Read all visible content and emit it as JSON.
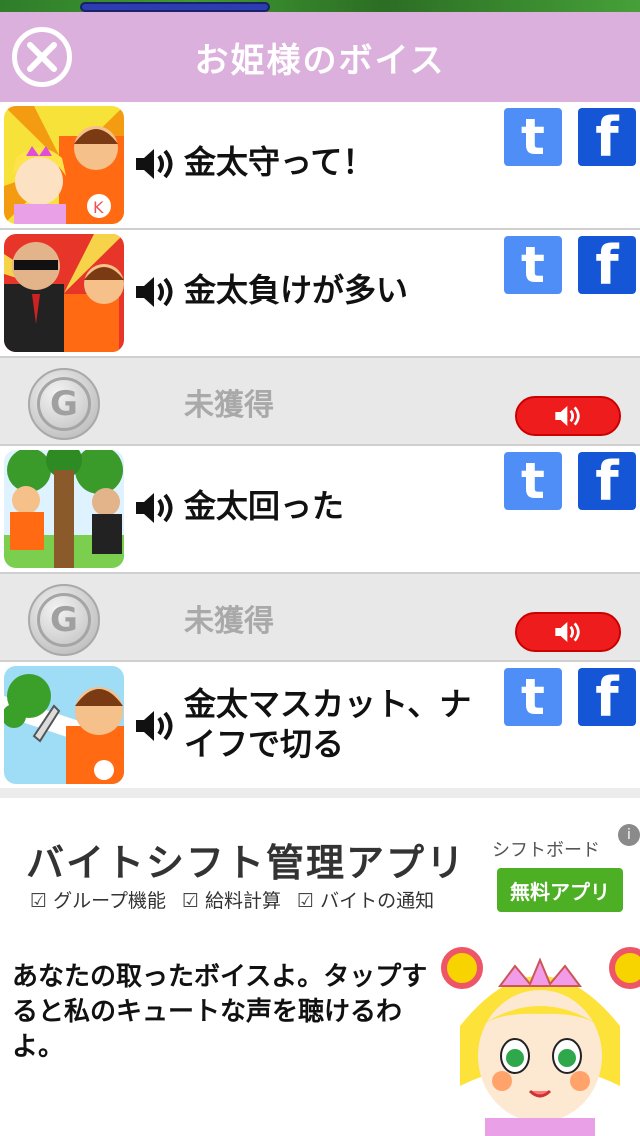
{
  "header": {
    "title": "お姫様のボイス"
  },
  "rows": [
    {
      "status": "unlocked",
      "title": "金太守って！"
    },
    {
      "status": "unlocked",
      "title": "金太負けが多い"
    },
    {
      "status": "locked",
      "coin_letter": "G",
      "label": "未獲得"
    },
    {
      "status": "unlocked",
      "title": "金太回った"
    },
    {
      "status": "locked",
      "coin_letter": "G",
      "label": "未獲得"
    },
    {
      "status": "unlocked",
      "title": "金太マスカット、ナイフで切る"
    }
  ],
  "share": {
    "tumblr_label": "t",
    "facebook_label": "f"
  },
  "ad": {
    "title": "バイトシフト管理アプリ",
    "features": [
      "グループ機能",
      "給料計算",
      "バイトの通知"
    ],
    "brand": "シフトボード",
    "cta": "無料アプリ",
    "info": "i"
  },
  "bottom": {
    "message": "あなたの取ったボイスよ。タップすると私のキュートな声を聴けるわよ。"
  },
  "colors": {
    "header_bg": "#dcb0dc",
    "tumblr": "#4f8ef7",
    "facebook": "#1456d6",
    "play": "#ee1c1c",
    "ad_cta": "#4caf24"
  }
}
